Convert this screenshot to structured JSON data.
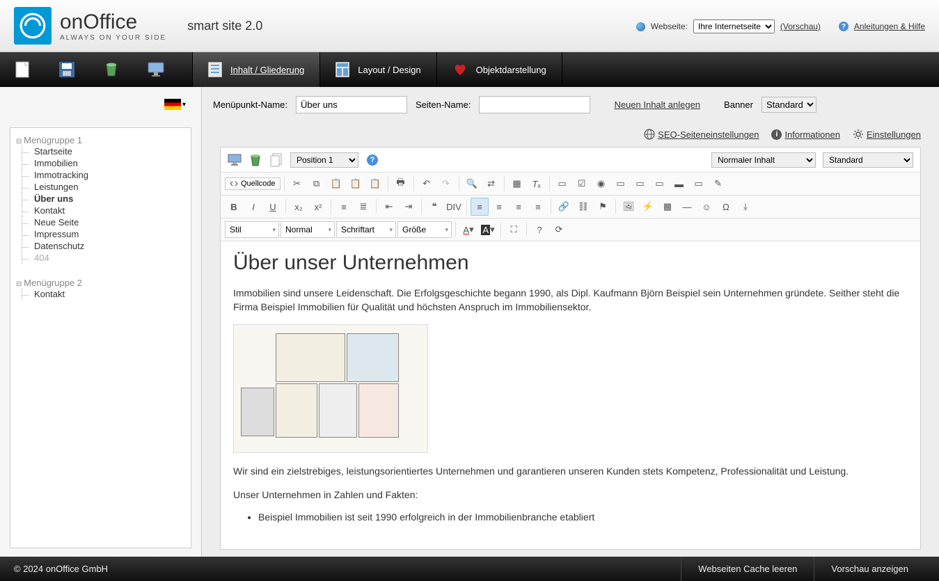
{
  "header": {
    "brand1": "on",
    "brand2": "Office",
    "slogan": "ALWAYS ON YOUR SIDE",
    "tagline": "smart site 2.0",
    "website_label": "Webseite:",
    "website_selected": "Ihre Internetseite",
    "preview": "(Vorschau)",
    "help": "Anleitungen & Hilfe"
  },
  "nav": {
    "content": "Inhalt / Gliederung",
    "layout": "Layout / Design",
    "objects": "Objektdarstellung"
  },
  "tree": {
    "g1": "Menügruppe 1",
    "g1items": [
      "Startseite",
      "Immobilien",
      "Immotracking",
      "Leistungen",
      "Über uns",
      "Kontakt",
      "Neue Seite",
      "Impressum",
      "Datenschutz",
      "404"
    ],
    "g1active": 4,
    "g1muted": 9,
    "g2": "Menügruppe 2",
    "g2items": [
      "Kontakt"
    ]
  },
  "form": {
    "menu_label": "Menüpunkt-Name:",
    "menu_value": "Über uns",
    "page_label": "Seiten-Name:",
    "page_value": "",
    "new_content": "Neuen Inhalt anlegen",
    "banner_label": "Banner",
    "banner_value": "Standard"
  },
  "settings": {
    "seo": "SEO-Seiteneinstellungen",
    "info": "Informationen",
    "conf": "Einstellungen"
  },
  "ed_top": {
    "position": "Position 1",
    "type_sel": "Normaler Inhalt",
    "std_sel": "Standard"
  },
  "tb": {
    "source": "Quellcode",
    "style": "Stil",
    "format": "Normal",
    "font": "Schriftart",
    "size": "Größe"
  },
  "content": {
    "h": "Über unser Unternehmen",
    "p1": "Immobilien sind unsere Leidenschaft. Die Erfolgsgeschichte begann 1990, als Dipl. Kaufmann Björn Beispiel sein Unternehmen gründete. Seither steht die Firma Beispiel Immobilien für Qualität und höchsten Anspruch im Immobiliensektor.",
    "p2": "Wir sind ein zielstrebiges, leistungsorientiertes Unternehmen und garantieren unseren Kunden stets Kompetenz, Professionalität und Leistung.",
    "p3": "Unser Unternehmen in Zahlen und Fakten:",
    "li1": "Beispiel Immobilien ist seit 1990 erfolgreich in der Immobilienbranche etabliert"
  },
  "footer": {
    "copy": "© 2024 onOffice GmbH",
    "cache": "Webseiten Cache leeren",
    "preview": "Vorschau anzeigen"
  }
}
